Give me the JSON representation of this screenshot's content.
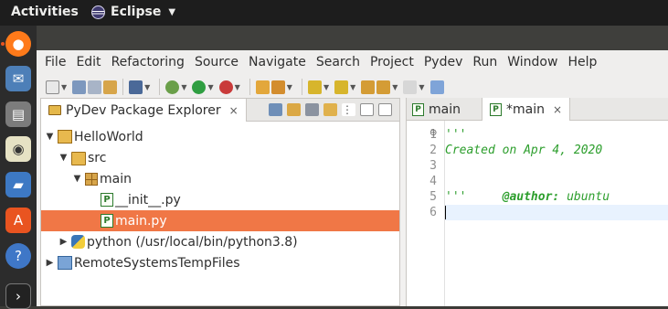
{
  "top_bar": {
    "activities": "Activities",
    "app_name": "Eclipse"
  },
  "menu": [
    "File",
    "Edit",
    "Refactoring",
    "Source",
    "Navigate",
    "Search",
    "Project",
    "Pydev",
    "Run",
    "Window",
    "Help"
  ],
  "package_explorer": {
    "title": "PyDev Package Explorer",
    "tree": [
      {
        "label": "HelloWorld",
        "twisty": "expanded",
        "icon": "project-icon"
      },
      {
        "label": "src",
        "twisty": "expanded",
        "icon": "folder-icon"
      },
      {
        "label": "main",
        "twisty": "expanded",
        "icon": "package-icon"
      },
      {
        "label": "__init__.py",
        "twisty": "",
        "icon": "python-file-icon"
      },
      {
        "label": "main.py",
        "twisty": "",
        "icon": "python-file-icon",
        "selected": true
      },
      {
        "label": "python  (/usr/local/bin/python3.8)",
        "twisty": "collapsed",
        "icon": "python-interpreter-icon"
      },
      {
        "label": "RemoteSystemsTempFiles",
        "twisty": "collapsed",
        "icon": "remote-folder-icon"
      }
    ]
  },
  "editor": {
    "tabs": [
      "main",
      "*main"
    ],
    "lines": [
      "'''",
      "Created on Apr 4, 2020",
      "",
      "@author: ubuntu",
      "'''",
      ""
    ],
    "author_keyword": "@author:",
    "author_value": " ubuntu"
  },
  "colors": {
    "selection": "#f07746",
    "comment_green": "#2c9e2c",
    "ubuntu_orange": "#e95420"
  }
}
